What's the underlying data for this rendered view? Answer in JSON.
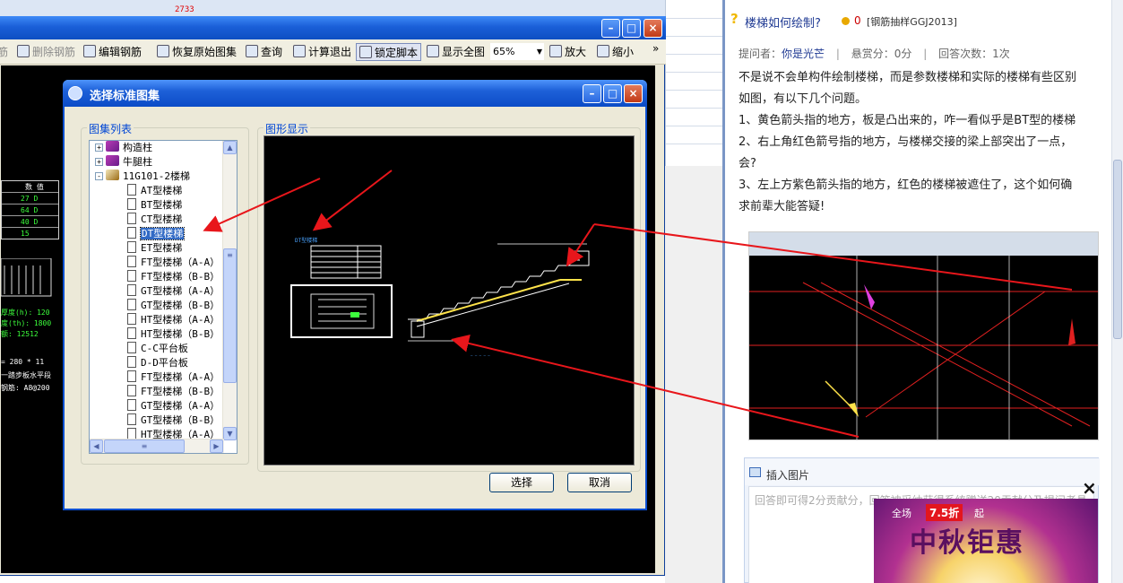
{
  "background": {
    "sheet_number": "2733"
  },
  "main_window": {
    "toolbar": [
      {
        "label": "筋",
        "disabled": true
      },
      {
        "label": "删除钢筋",
        "disabled": true
      },
      {
        "label": "编辑钢筋",
        "disabled": false
      },
      {
        "label": "恢复原始图集",
        "disabled": false
      },
      {
        "label": "查询",
        "disabled": false
      },
      {
        "label": "计算退出",
        "disabled": false
      },
      {
        "label": "锁定脚本",
        "disabled": false,
        "pressed": true
      },
      {
        "label": "显示全图",
        "disabled": false
      },
      {
        "label": "放大",
        "disabled": false
      },
      {
        "label": "缩小",
        "disabled": false
      }
    ],
    "zoom_value": "65%",
    "overflow_glyph": "»",
    "cad_background": {
      "table_header": [
        "数 值"
      ],
      "table_values": [
        "27 D",
        "64 D",
        "40 D",
        "15"
      ],
      "notes": [
        "厚度(h): 120",
        "度(th): 1800",
        "额: 12512",
        "= 280 * 11",
        "一踏步板水平段",
        "钢筋: A8@200"
      ]
    }
  },
  "dialog": {
    "title": "选择标准图集",
    "list_group_label": "图集列表",
    "preview_group_label": "图形显示",
    "tree": [
      {
        "label": "构造柱",
        "level": 0,
        "expand": "+",
        "icon": "book"
      },
      {
        "label": "牛腿柱",
        "level": 0,
        "expand": "+",
        "icon": "book"
      },
      {
        "label": "11G101-2楼梯",
        "level": 0,
        "expand": "-",
        "icon": "book-open"
      },
      {
        "label": "AT型楼梯",
        "level": 1,
        "icon": "doc"
      },
      {
        "label": "BT型楼梯",
        "level": 1,
        "icon": "doc"
      },
      {
        "label": "CT型楼梯",
        "level": 1,
        "icon": "doc"
      },
      {
        "label": "DT型楼梯",
        "level": 1,
        "icon": "doc",
        "selected": true
      },
      {
        "label": "ET型楼梯",
        "level": 1,
        "icon": "doc"
      },
      {
        "label": "FT型楼梯（A-A）",
        "level": 1,
        "icon": "doc"
      },
      {
        "label": "FT型楼梯（B-B）",
        "level": 1,
        "icon": "doc"
      },
      {
        "label": "GT型楼梯（A-A）",
        "level": 1,
        "icon": "doc"
      },
      {
        "label": "GT型楼梯（B-B）",
        "level": 1,
        "icon": "doc"
      },
      {
        "label": "HT型楼梯（A-A）",
        "level": 1,
        "icon": "doc"
      },
      {
        "label": "HT型楼梯（B-B）",
        "level": 1,
        "icon": "doc"
      },
      {
        "label": "C-C平台板",
        "level": 1,
        "icon": "doc"
      },
      {
        "label": "D-D平台板",
        "level": 1,
        "icon": "doc"
      },
      {
        "label": "FT型楼梯（A-A）",
        "level": 1,
        "icon": "doc"
      },
      {
        "label": "FT型楼梯（B-B）",
        "level": 1,
        "icon": "doc"
      },
      {
        "label": "GT型楼梯（A-A）",
        "level": 1,
        "icon": "doc"
      },
      {
        "label": "GT型楼梯（B-B）",
        "level": 1,
        "icon": "doc"
      },
      {
        "label": "HT型楼梯（A-A）",
        "level": 1,
        "icon": "doc"
      }
    ],
    "preview_caption": "DT型楼梯",
    "select_button": "选择",
    "cancel_button": "取消"
  },
  "qa_panel": {
    "title": "楼梯如何绘制?",
    "bounty": "0",
    "category": "[钢筋抽样GGJ2013]",
    "meta": {
      "asker_label": "提问者：",
      "asker": "你是光芒",
      "reward_label": "悬赏分：",
      "reward": "0分",
      "answers_label": "回答次数：",
      "answers": "1次"
    },
    "body_lines": [
      "不是说不会单构件绘制楼梯，而是参数楼梯和实际的楼梯有些区别",
      "如图，有以下几个问题。",
      "1、黄色箭头指的地方，板是凸出来的，咋一看似乎是BT型的楼梯",
      "2、右上角红色箭号指的地方，与楼梯交接的梁上部突出了一点，",
      "会?",
      "3、左上方紫色箭头指的地方，红色的楼梯被遮住了，这个如何确",
      "求前辈大能答疑!"
    ],
    "insert_image": "插入图片",
    "answer_placeholder": "回答即可得2分贡献分，回答被采纳获得系统赠送20贡献分及提问者悬",
    "ad": {
      "pre": "全场",
      "badge": "7.5折",
      "post": "起",
      "main": "中秋钜惠"
    },
    "close_glyph": "×"
  },
  "colors": {
    "annotation_arrow": "#e8161b",
    "xp_title_blue": "#0b4fd1",
    "link_blue": "#1f3a93"
  }
}
